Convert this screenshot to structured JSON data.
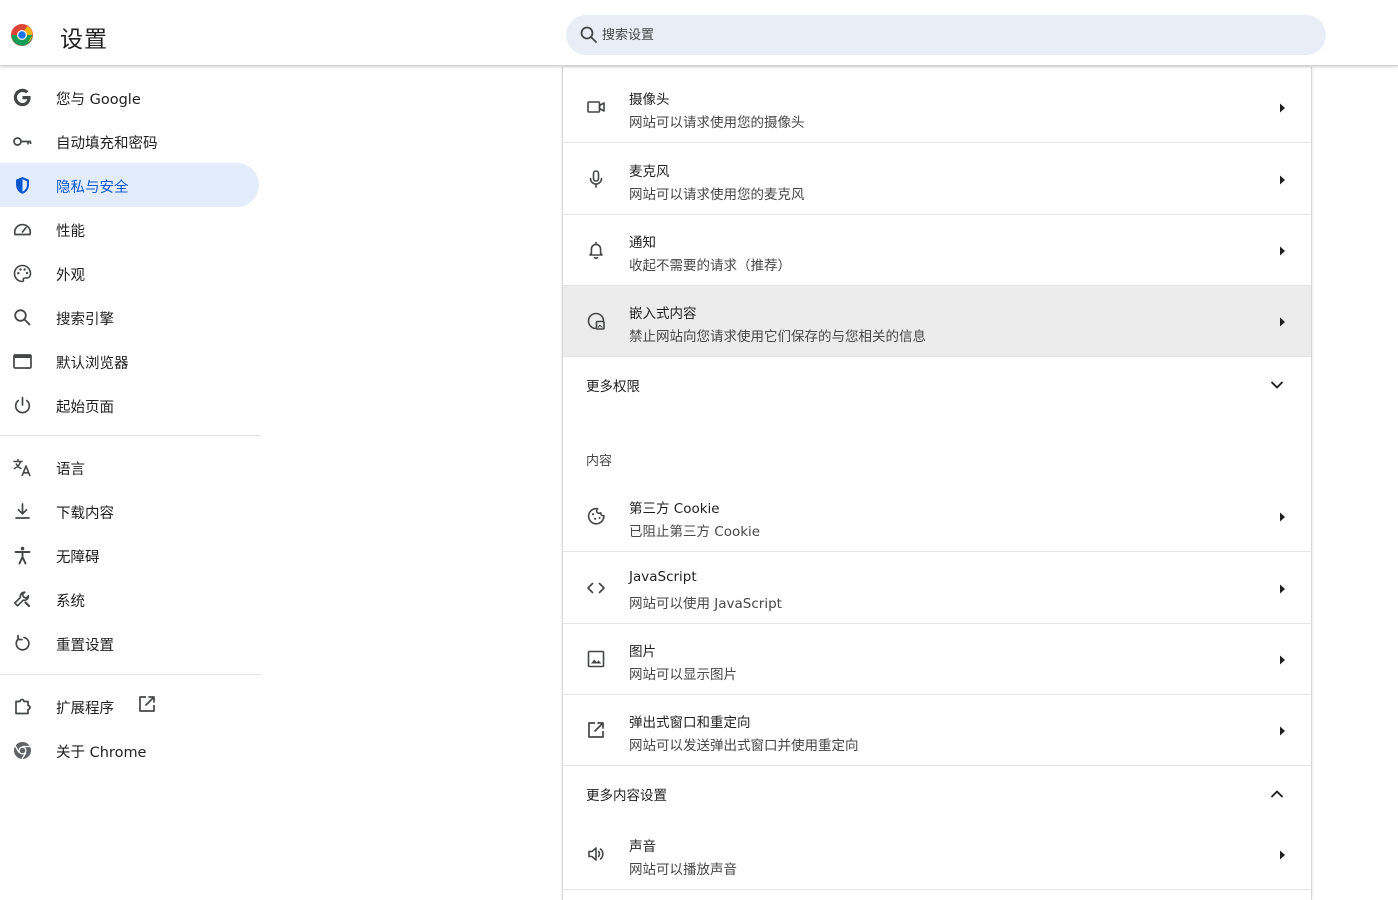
{
  "header": {
    "title": "设置",
    "search_placeholder": "搜索设置"
  },
  "sidebar": {
    "items": [
      {
        "label": "您与 Google",
        "icon": "google-g-icon"
      },
      {
        "label": "自动填充和密码",
        "icon": "key-icon"
      },
      {
        "label": "隐私与安全",
        "icon": "shield-icon",
        "active": true
      },
      {
        "label": "性能",
        "icon": "speedometer-icon"
      },
      {
        "label": "外观",
        "icon": "palette-icon"
      },
      {
        "label": "搜索引擎",
        "icon": "search-icon"
      },
      {
        "label": "默认浏览器",
        "icon": "browser-window-icon"
      },
      {
        "label": "起始页面",
        "icon": "power-icon"
      },
      {
        "label": "语言",
        "icon": "translate-icon"
      },
      {
        "label": "下载内容",
        "icon": "download-icon"
      },
      {
        "label": "无障碍",
        "icon": "accessibility-icon"
      },
      {
        "label": "系统",
        "icon": "wrench-icon"
      },
      {
        "label": "重置设置",
        "icon": "reset-icon"
      },
      {
        "label": "扩展程序",
        "icon": "puzzle-icon"
      },
      {
        "label": "关于 Chrome",
        "icon": "chrome-icon"
      }
    ]
  },
  "permissions": {
    "rows": [
      {
        "title": "摄像头",
        "subtitle": "网站可以请求使用您的摄像头",
        "icon": "camera-icon"
      },
      {
        "title": "麦克风",
        "subtitle": "网站可以请求使用您的麦克风",
        "icon": "microphone-icon"
      },
      {
        "title": "通知",
        "subtitle": "收起不需要的请求（推荐）",
        "icon": "bell-icon"
      },
      {
        "title": "嵌入式内容",
        "subtitle": "禁止网站向您请求使用它们保存的与您相关的信息",
        "icon": "embedded-content-icon"
      }
    ],
    "more_label": "更多权限"
  },
  "content": {
    "heading": "内容",
    "rows": [
      {
        "title": "第三方 Cookie",
        "subtitle": "已阻止第三方 Cookie",
        "icon": "cookie-icon"
      },
      {
        "title": "JavaScript",
        "subtitle": "网站可以使用 JavaScript",
        "icon": "code-icon"
      },
      {
        "title": "图片",
        "subtitle": "网站可以显示图片",
        "icon": "image-icon"
      },
      {
        "title": "弹出式窗口和重定向",
        "subtitle": "网站可以发送弹出式窗口并使用重定向",
        "icon": "open-in-new-icon"
      }
    ],
    "more_label": "更多内容设置",
    "more_rows": [
      {
        "title": "声音",
        "subtitle": "网站可以播放声音",
        "icon": "speaker-icon"
      }
    ]
  },
  "colors": {
    "accent": "#0b57d0",
    "active_bg": "#e3ecfb",
    "search_bg": "#e9eef6",
    "hover_row": "#ececec"
  }
}
